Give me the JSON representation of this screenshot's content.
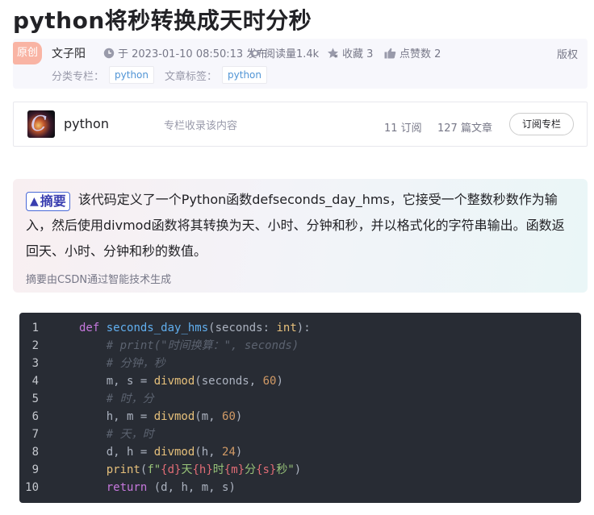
{
  "article": {
    "title": "python将秒转换成天时分秒"
  },
  "meta": {
    "original_badge": "原创",
    "author": "文子阳",
    "publish_text": "于 2023-01-10 08:50:13 发布",
    "views_text": "阅读量1.4k",
    "favorites_text": "收藏 3",
    "likes_text": "点赞数 2",
    "copyright_label": "版权",
    "category_label": "分类专栏：",
    "category_tag": "python",
    "article_tag_label": "文章标签：",
    "article_tag": "python"
  },
  "column": {
    "image_letter": "C",
    "name": "python",
    "description": "专栏收录该内容",
    "subscriptions": "11 订阅",
    "articles": "127 篇文章",
    "subscribe_button": "订阅专栏"
  },
  "summary": {
    "badge": "摘要",
    "text": "该代码定义了一个Python函数defseconds_day_hms，它接受一个整数秒数作为输入，然后使用divmod函数将其转换为天、小时、分钟和秒，并以格式化的字符串输出。函数返回天、小时、分钟和秒的数值。",
    "footer": "摘要由CSDN通过智能技术生成"
  },
  "code": {
    "line_numbers": [
      "1",
      "2",
      "3",
      "4",
      "5",
      "6",
      "7",
      "8",
      "9",
      "10"
    ],
    "lines": [
      [
        {
          "t": "def",
          "c": "kw"
        },
        {
          "t": " ",
          "c": "pl"
        },
        {
          "t": "seconds_day_hms",
          "c": "fn"
        },
        {
          "t": "(seconds: ",
          "c": "pl"
        },
        {
          "t": "int",
          "c": "bi"
        },
        {
          "t": "):",
          "c": "pl"
        }
      ],
      [
        {
          "t": "    # print(\"时间换算：\", seconds)",
          "c": "cm"
        }
      ],
      [
        {
          "t": "    # 分钟，秒",
          "c": "cm"
        }
      ],
      [
        {
          "t": "    m, s = ",
          "c": "pl"
        },
        {
          "t": "divmod",
          "c": "bi"
        },
        {
          "t": "(seconds, ",
          "c": "pl"
        },
        {
          "t": "60",
          "c": "num"
        },
        {
          "t": ")",
          "c": "pl"
        }
      ],
      [
        {
          "t": "    # 时，分",
          "c": "cm"
        }
      ],
      [
        {
          "t": "    h, m = ",
          "c": "pl"
        },
        {
          "t": "divmod",
          "c": "bi"
        },
        {
          "t": "(m, ",
          "c": "pl"
        },
        {
          "t": "60",
          "c": "num"
        },
        {
          "t": ")",
          "c": "pl"
        }
      ],
      [
        {
          "t": "    # 天，时",
          "c": "cm"
        }
      ],
      [
        {
          "t": "    d, h = ",
          "c": "pl"
        },
        {
          "t": "divmod",
          "c": "bi"
        },
        {
          "t": "(h, ",
          "c": "pl"
        },
        {
          "t": "24",
          "c": "num"
        },
        {
          "t": ")",
          "c": "pl"
        }
      ],
      [
        {
          "t": "    ",
          "c": "pl"
        },
        {
          "t": "print",
          "c": "bi"
        },
        {
          "t": "(",
          "c": "pl"
        },
        {
          "t": "f\"",
          "c": "str"
        },
        {
          "t": "{d}",
          "c": "interp"
        },
        {
          "t": "天",
          "c": "str"
        },
        {
          "t": "{h}",
          "c": "interp"
        },
        {
          "t": "时",
          "c": "str"
        },
        {
          "t": "{m}",
          "c": "interp"
        },
        {
          "t": "分",
          "c": "str"
        },
        {
          "t": "{s}",
          "c": "interp"
        },
        {
          "t": "秒\"",
          "c": "str"
        },
        {
          "t": ")",
          "c": "pl"
        }
      ],
      [
        {
          "t": "    ",
          "c": "pl"
        },
        {
          "t": "return",
          "c": "kw"
        },
        {
          "t": " (d, h, m, s)",
          "c": "pl"
        }
      ]
    ]
  },
  "colors": {
    "code_background": "#282c34",
    "tag_text": "#5094d5",
    "original_badge": "#f9b4a4"
  }
}
